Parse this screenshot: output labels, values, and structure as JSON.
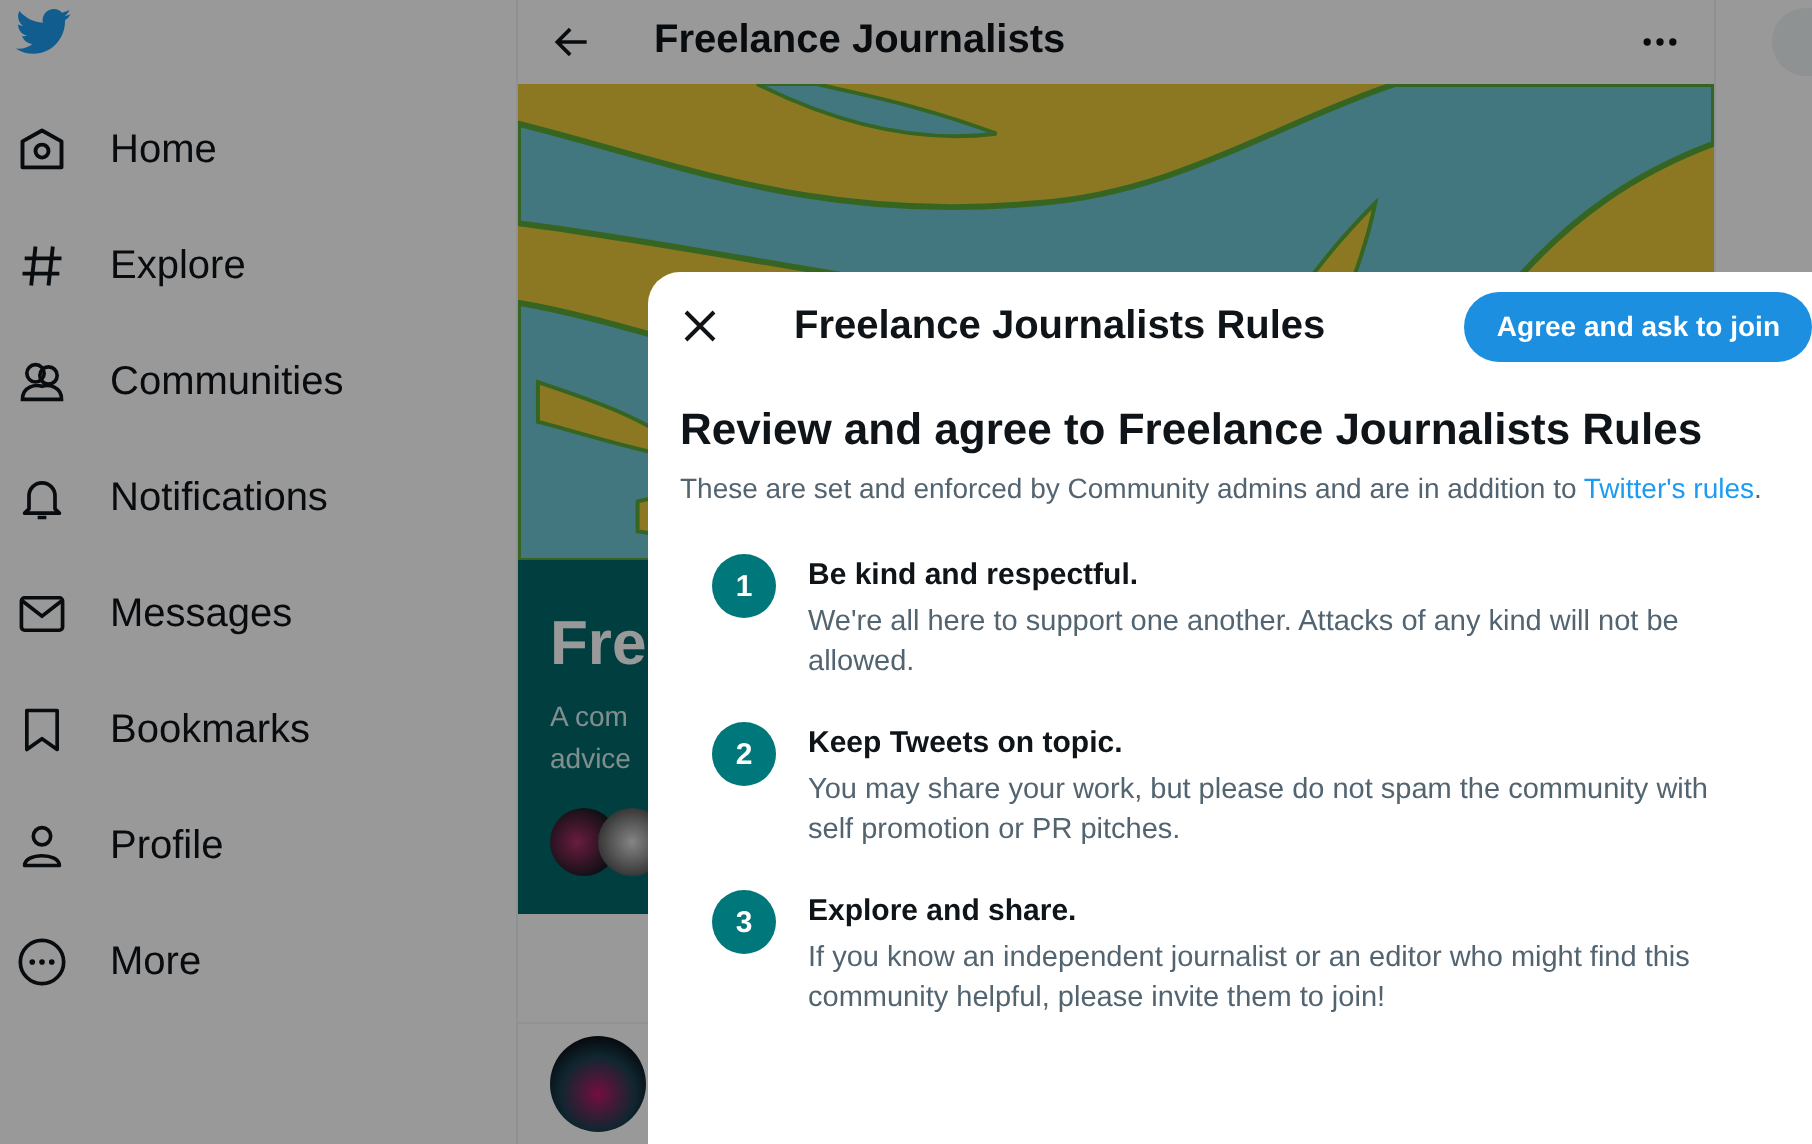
{
  "sidebar": {
    "items": [
      {
        "label": "Home"
      },
      {
        "label": "Explore"
      },
      {
        "label": "Communities"
      },
      {
        "label": "Notifications"
      },
      {
        "label": "Messages"
      },
      {
        "label": "Bookmarks"
      },
      {
        "label": "Profile"
      },
      {
        "label": "More"
      }
    ]
  },
  "main": {
    "title": "Freelance Journalists",
    "card": {
      "name": "Fre",
      "description": [
        "A com",
        "advice"
      ]
    }
  },
  "modal": {
    "title": "Freelance Journalists Rules",
    "join_button": "Agree and ask to join",
    "heading": "Review and agree to Freelance Journalists Rules",
    "intro": "These are set and enforced by Community admins and are in addition to ",
    "intro_link": "Twitter's rules",
    "intro_end": ".",
    "rules": [
      {
        "number": "1",
        "title": "Be kind and respectful.",
        "text": "We're all here to support one another. Attacks of any kind will not be allowed."
      },
      {
        "number": "2",
        "title": "Keep Tweets on topic.",
        "text": "You may share your work, but please do not spam the community with self promotion or PR pitches."
      },
      {
        "number": "3",
        "title": "Explore and share.",
        "text": "If you know an independent journalist or an editor who might find this community helpful, please invite them to join!"
      }
    ]
  }
}
